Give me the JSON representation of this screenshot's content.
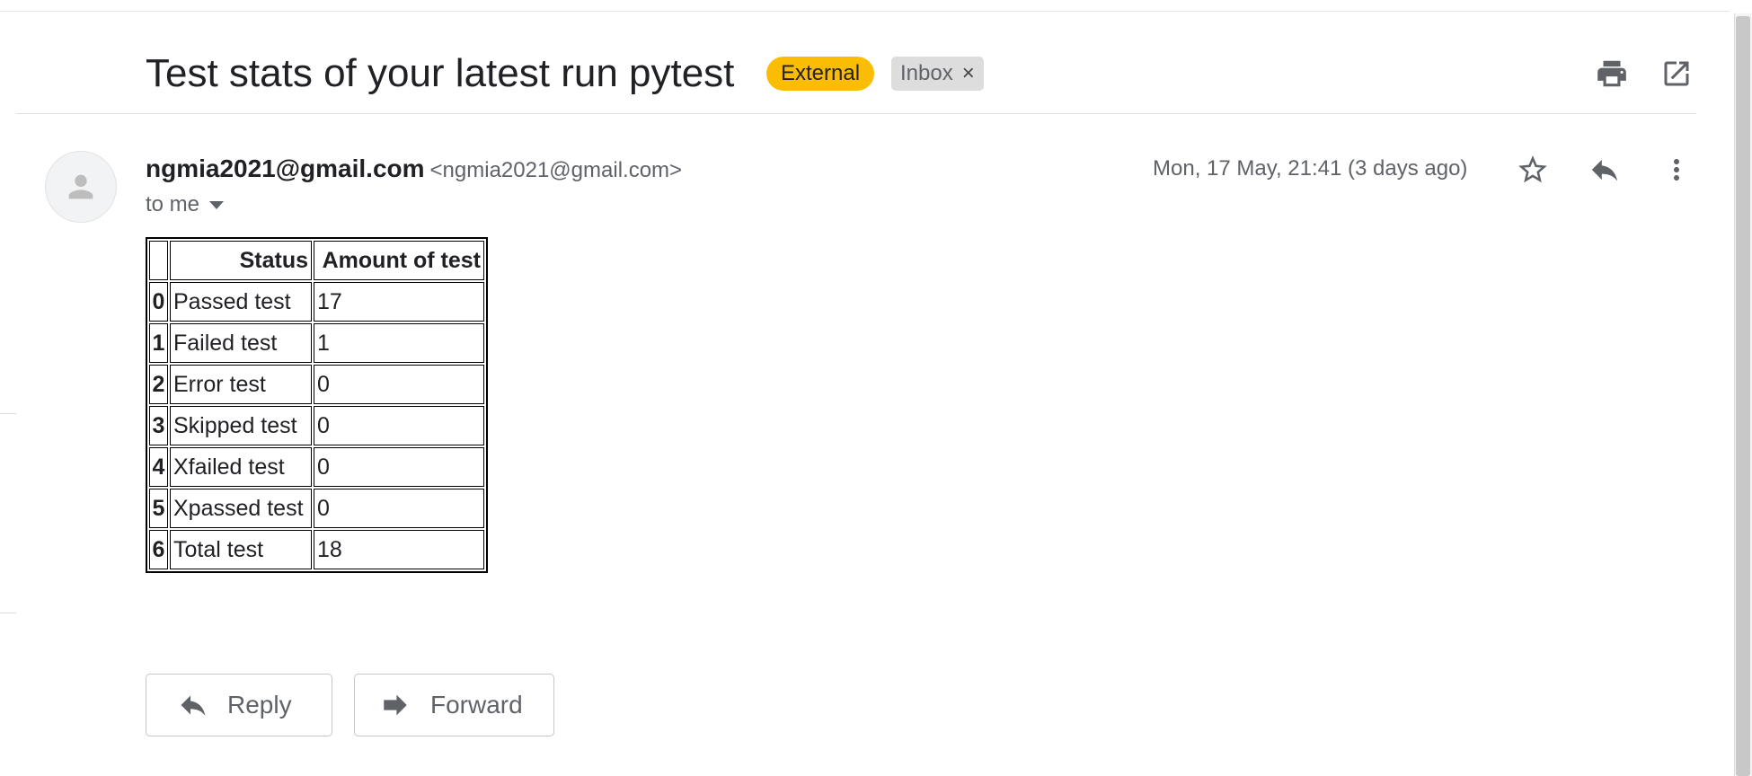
{
  "email": {
    "subject": "Test stats of your latest run pytest",
    "labels": {
      "external": "External",
      "inbox": "Inbox",
      "remove_glyph": "×"
    },
    "sender": {
      "name": "ngmia2021@gmail.com",
      "email": "<ngmia2021@gmail.com>"
    },
    "recipient_text": "to me",
    "date": "Mon, 17 May, 21:41 (3 days ago)"
  },
  "stats_table": {
    "headers": [
      "",
      "Status",
      "Amount of test"
    ],
    "rows": [
      {
        "index": "0",
        "status": "Passed test",
        "amount": "17"
      },
      {
        "index": "1",
        "status": "Failed test",
        "amount": "1"
      },
      {
        "index": "2",
        "status": "Error test",
        "amount": "0"
      },
      {
        "index": "3",
        "status": "Skipped test",
        "amount": "0"
      },
      {
        "index": "4",
        "status": "Xfailed test",
        "amount": "0"
      },
      {
        "index": "5",
        "status": "Xpassed test",
        "amount": "0"
      },
      {
        "index": "6",
        "status": "Total test",
        "amount": "18"
      }
    ]
  },
  "actions": {
    "reply_label": "Reply",
    "forward_label": "Forward"
  },
  "icons": {
    "print": "print-icon",
    "open_new_window": "open-in-new-window-icon",
    "star": "star-icon",
    "reply": "reply-icon",
    "more": "more-vertical-icon",
    "avatar": "default-avatar-icon",
    "dropdown": "caret-down-icon",
    "forward": "forward-icon"
  },
  "colors": {
    "external_chip": "#fbbc04",
    "inbox_chip": "#dddddd",
    "icon_gray": "#5f6368",
    "text_dark": "#202124"
  }
}
